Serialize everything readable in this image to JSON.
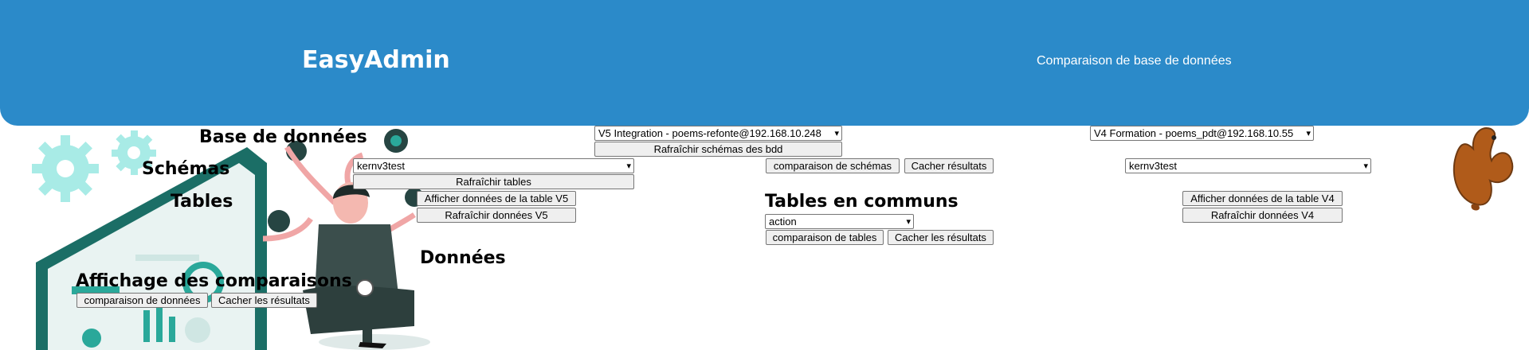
{
  "header": {
    "brand": "EasyAdmin",
    "subtitle": "Comparaison de base de données",
    "background_color": "#2b8ac9"
  },
  "labels": {
    "database": "Base de données",
    "schemas": "Schémas",
    "tables": "Tables",
    "common_tables": "Tables en communs",
    "data": "Données",
    "comparisons_display": "Affichage des comparaisons"
  },
  "left": {
    "db_select": "V5 Integration - poems-refonte@192.168.10.248",
    "refresh_schemas": "Rafraîchir schémas des bdd",
    "schema_select": "kernv3test",
    "refresh_tables": "Rafraîchir tables",
    "show_table_data": "Afficher données de la table V5",
    "refresh_data": "Rafraîchir données V5"
  },
  "right": {
    "db_select": "V4 Formation - poems_pdt@192.168.10.55",
    "schema_select": "kernv3test",
    "show_table_data": "Afficher données de la table V4",
    "refresh_data": "Rafraîchir données V4"
  },
  "middle": {
    "compare_schemas": "comparaison de schémas",
    "hide_results": "Cacher résultats",
    "common_table_select": "action",
    "compare_tables": "comparaison de tables",
    "hide_table_results": "Cacher les résultats"
  },
  "bottom": {
    "compare_data": "comparaison de données",
    "hide_data_results": "Cacher les résultats"
  },
  "icons": {
    "dropdown": "▾"
  }
}
